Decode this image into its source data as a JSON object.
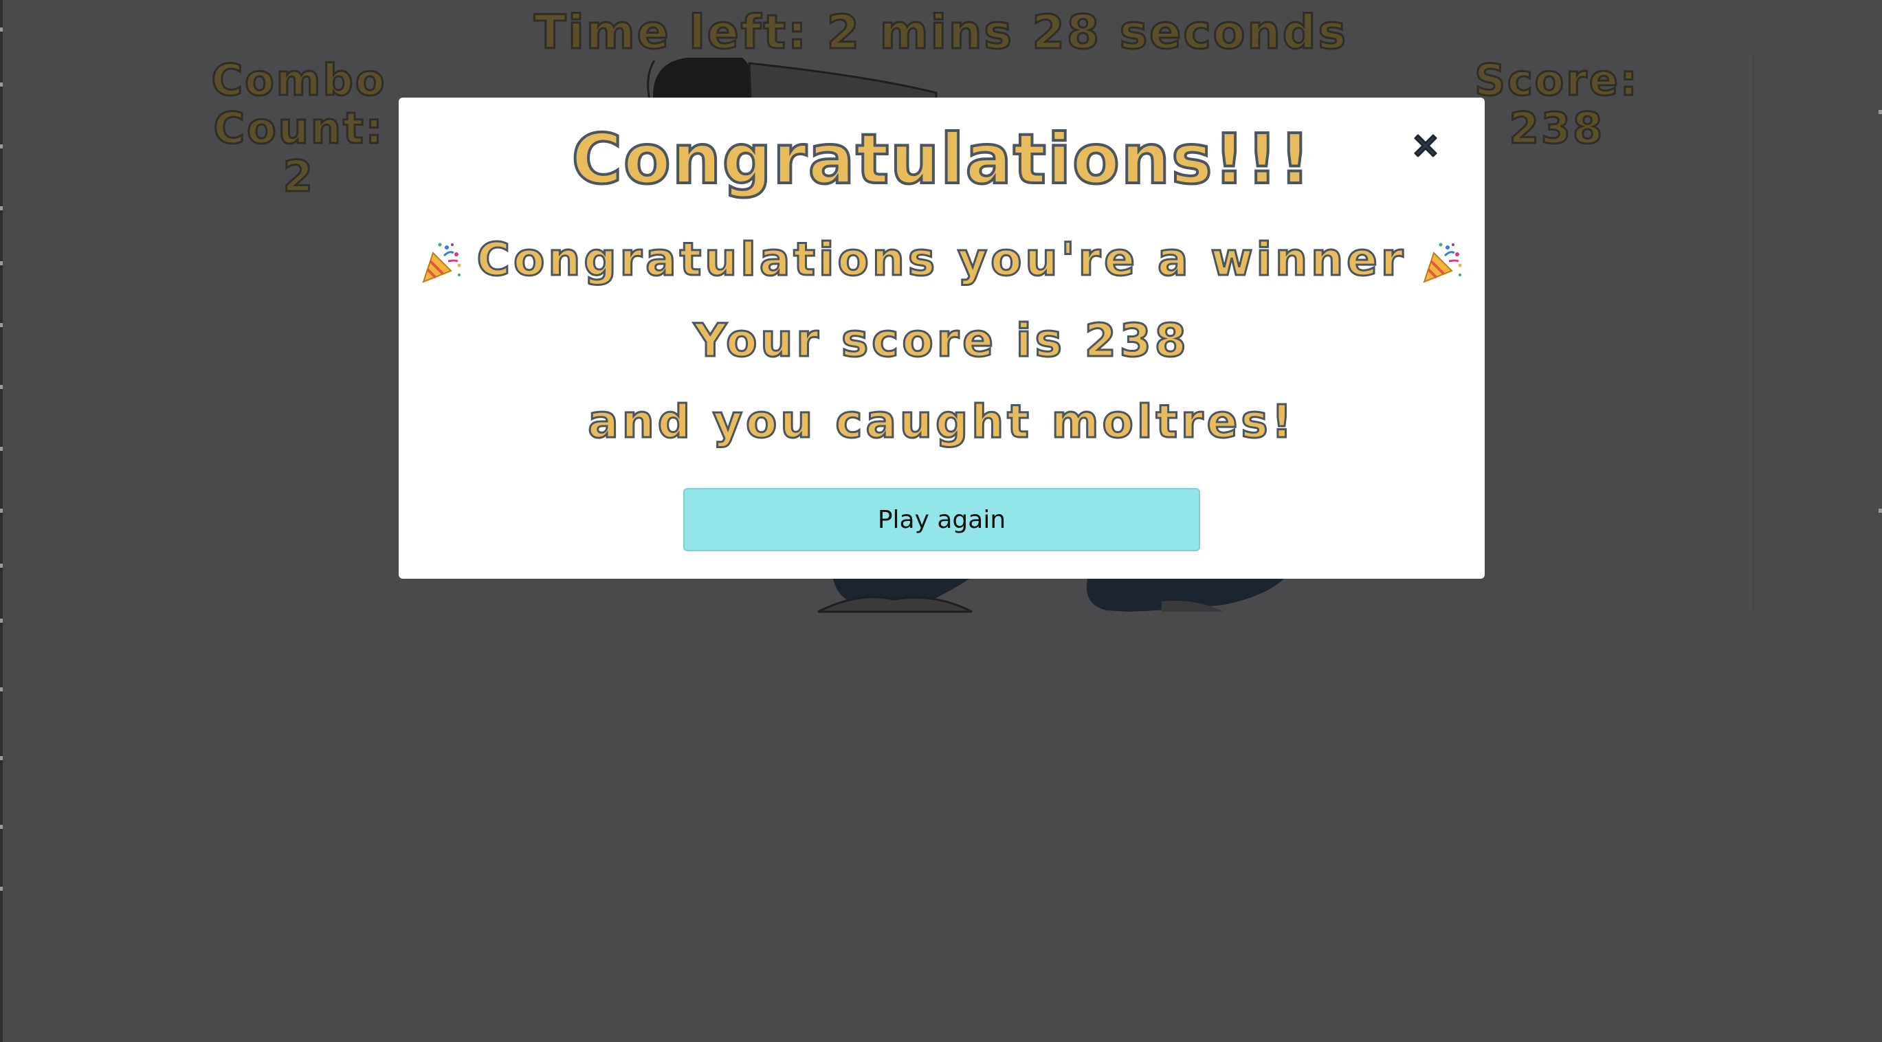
{
  "hud": {
    "timer_text": "Time left: 2 mins 28 seconds",
    "combo_label_line1": "Combo",
    "combo_label_line2": "Count:",
    "combo_value": "2",
    "score_label": "Score:",
    "score_value": "238"
  },
  "modal": {
    "title": "Congratulations!!!",
    "winner_text": "Congratulations you're a winner",
    "score_text": "Your score is 238",
    "caught_text": "and you caught moltres!",
    "play_again_label": "Play again",
    "close_icon": "close-icon",
    "confetti_icon": "party-popper-icon"
  },
  "colors": {
    "overlay_bg": "#4a4a4c",
    "modal_bg": "#ffffff",
    "title_fill": "#e8bb5c",
    "title_stroke": "#4a5560",
    "button_bg": "#93e6e8",
    "hud_dim_text": "#5a4f2a"
  }
}
